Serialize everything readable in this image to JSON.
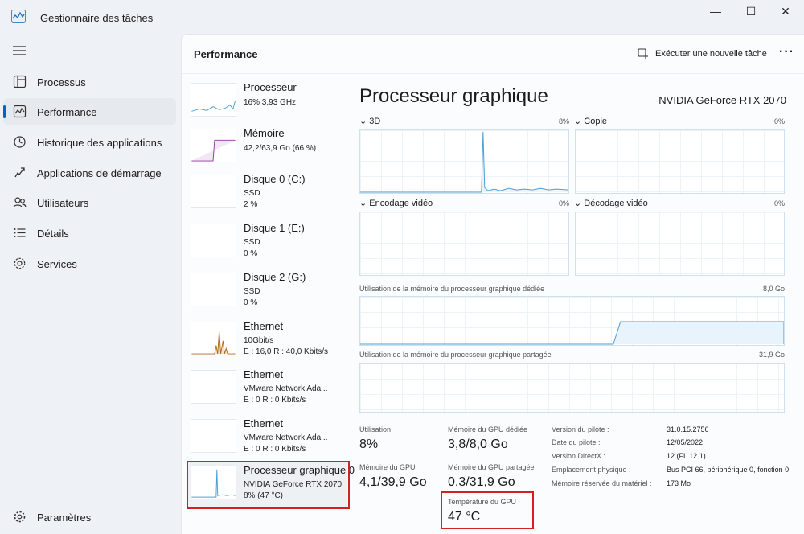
{
  "window": {
    "title": "Gestionnaire des tâches",
    "minimize": "—",
    "maximize": "☐",
    "close": "✕"
  },
  "sidebar": {
    "items": [
      {
        "label": "Processus",
        "icon": "processes-icon"
      },
      {
        "label": "Performance",
        "icon": "performance-icon",
        "active": true
      },
      {
        "label": "Historique des applications",
        "icon": "history-icon"
      },
      {
        "label": "Applications de démarrage",
        "icon": "startup-icon"
      },
      {
        "label": "Utilisateurs",
        "icon": "users-icon"
      },
      {
        "label": "Détails",
        "icon": "details-icon"
      },
      {
        "label": "Services",
        "icon": "services-icon"
      }
    ],
    "settings": {
      "label": "Paramètres",
      "icon": "gear-icon"
    }
  },
  "header": {
    "title": "Performance",
    "run_task": "Exécuter une nouvelle tâche",
    "more": "···"
  },
  "resources": [
    {
      "name": "Processeur",
      "line1": "16%  3,93 GHz",
      "line2": ""
    },
    {
      "name": "Mémoire",
      "line1": "42,2/63,9 Go (66 %)",
      "line2": ""
    },
    {
      "name": "Disque 0 (C:)",
      "line1": "SSD",
      "line2": "2 %"
    },
    {
      "name": "Disque 1 (E:)",
      "line1": "SSD",
      "line2": "0 %"
    },
    {
      "name": "Disque 2 (G:)",
      "line1": "SSD",
      "line2": "0 %"
    },
    {
      "name": "Ethernet",
      "line1": "10Gbit/s",
      "line2": "E : 16,0 R : 40,0 Kbits/s"
    },
    {
      "name": "Ethernet",
      "line1": "VMware Network Ada...",
      "line2": "E : 0 R : 0 Kbits/s"
    },
    {
      "name": "Ethernet",
      "line1": "VMware Network Ada...",
      "line2": "E : 0 R : 0 Kbits/s"
    },
    {
      "name": "Processeur graphique 0",
      "line1": "NVIDIA GeForce RTX 2070",
      "line2": "8%  (47 °C)",
      "selected": true
    }
  ],
  "gpu": {
    "title": "Processeur graphique",
    "model": "NVIDIA GeForce RTX 2070",
    "engines": [
      {
        "label": "3D",
        "pct": "8%"
      },
      {
        "label": "Copie",
        "pct": "0%"
      },
      {
        "label": "Encodage vidéo",
        "pct": "0%"
      },
      {
        "label": "Décodage vidéo",
        "pct": "0%"
      }
    ],
    "dedicated_label": "Utilisation de la mémoire du processeur graphique dédiée",
    "dedicated_max": "8,0 Go",
    "shared_label": "Utilisation de la mémoire du processeur graphique partagée",
    "shared_max": "31,9 Go",
    "stats": {
      "utilisation_label": "Utilisation",
      "utilisation": "8%",
      "dedicated_mem_label": "Mémoire du GPU dédiée",
      "dedicated_mem": "3,8/8,0 Go",
      "gpu_mem_label": "Mémoire du GPU",
      "gpu_mem": "4,1/39,9 Go",
      "shared_mem_label": "Mémoire du GPU partagée",
      "shared_mem": "0,3/31,9 Go",
      "temp_label": "Température du GPU",
      "temp": "47 °C"
    },
    "info": [
      {
        "k": "Version du pilote :",
        "v": "31.0.15.2756"
      },
      {
        "k": "Date du pilote :",
        "v": "12/05/2022"
      },
      {
        "k": "Version DirectX :",
        "v": "12 (FL 12.1)"
      },
      {
        "k": "Emplacement physique :",
        "v": "Bus PCI 66, périphérique 0, fonction 0"
      },
      {
        "k": "Mémoire réservée du matériel :",
        "v": "173 Mo"
      }
    ]
  },
  "colors": {
    "accent": "#0067c0",
    "gpu_line": "#4a9fd4",
    "mem_line": "#8e3a9e",
    "net_line": "#b36a1a",
    "highlight": "#d42020"
  }
}
